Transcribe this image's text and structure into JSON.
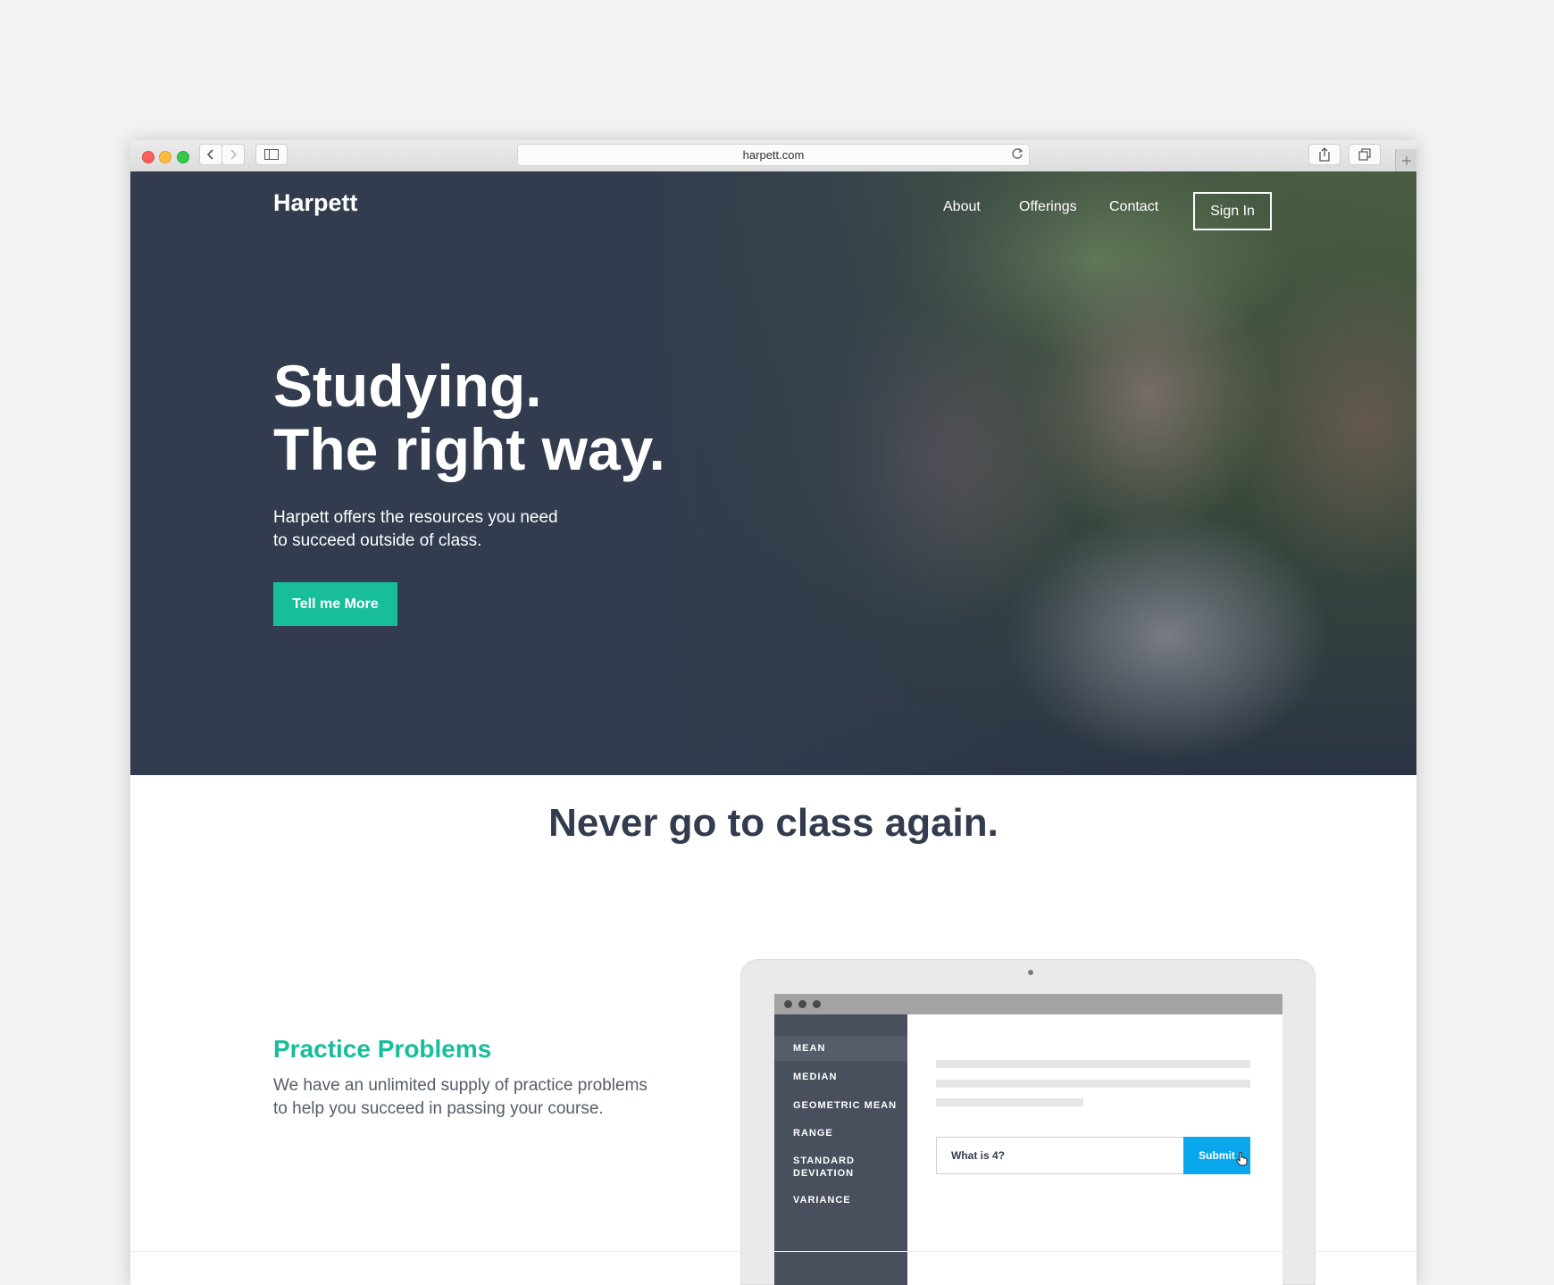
{
  "browser": {
    "url": "harpett.com",
    "icons": [
      "back-icon",
      "forward-icon",
      "sidebar-icon",
      "reload-icon",
      "share-icon",
      "tabs-icon",
      "plus-icon"
    ]
  },
  "header": {
    "logo": "Harpett",
    "nav": [
      "About",
      "Offerings",
      "Contact"
    ],
    "signin": "Sign In"
  },
  "hero": {
    "title_line1": "Studying.",
    "title_line2": "The right way.",
    "subtitle_line1": "Harpett offers the resources you need",
    "subtitle_line2": "to succeed outside of class.",
    "cta": "Tell me More"
  },
  "section": {
    "title": "Never go to class again."
  },
  "feature": {
    "title": "Practice Problems",
    "text_line1": "We have an unlimited supply of practice problems",
    "text_line2": "to help you succeed in passing your course."
  },
  "mockup": {
    "menu": [
      "MEAN",
      "MEDIAN",
      "GEOMETRIC MEAN",
      "RANGE",
      "STANDARD DEVIATION",
      "VARIANCE"
    ],
    "standard_line1": "STANDARD",
    "standard_line2": "DEVIATION",
    "question": "What is 4?",
    "submit": "Submit"
  },
  "colors": {
    "hero_bg": "#323c4e",
    "accent_green": "#17be99",
    "submit_blue": "#09a8ed",
    "sidebar": "#48505e"
  }
}
